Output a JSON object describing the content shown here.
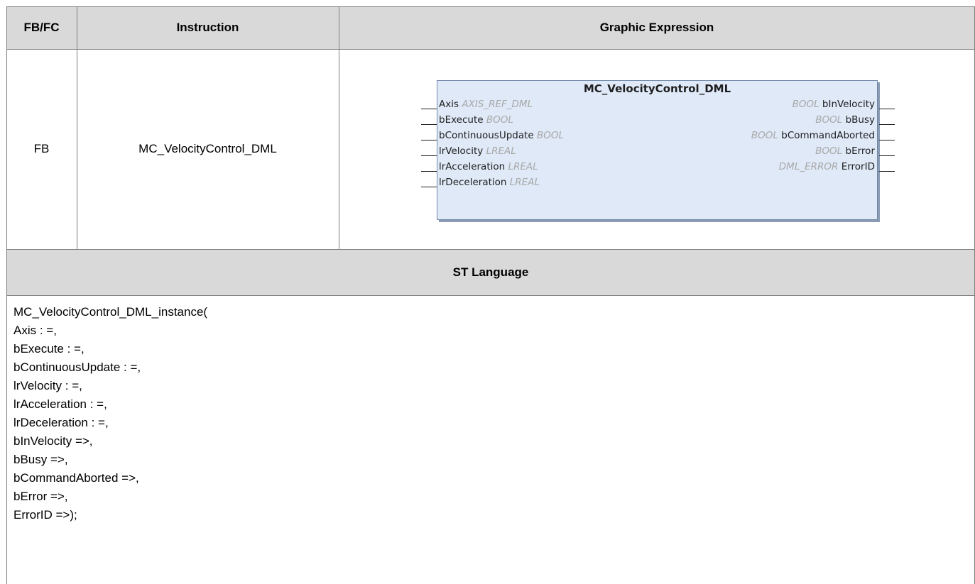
{
  "table": {
    "headers": {
      "col1": "FB/FC",
      "col2": "Instruction",
      "col3": "Graphic Expression"
    },
    "row": {
      "fb_fc": "FB",
      "instruction": "MC_VelocityControl_DML"
    },
    "st_header": "ST Language"
  },
  "block": {
    "title": "MC_VelocityControl_DML",
    "inputs": [
      {
        "name": "Axis",
        "type": "AXIS_REF_DML"
      },
      {
        "name": "bExecute",
        "type": "BOOL"
      },
      {
        "name": "bContinuousUpdate",
        "type": "BOOL"
      },
      {
        "name": "lrVelocity",
        "type": "LREAL"
      },
      {
        "name": "lrAcceleration",
        "type": "LREAL"
      },
      {
        "name": "lrDeceleration",
        "type": "LREAL"
      }
    ],
    "outputs": [
      {
        "name": "bInVelocity",
        "type": "BOOL"
      },
      {
        "name": "bBusy",
        "type": "BOOL"
      },
      {
        "name": "bCommandAborted",
        "type": "BOOL"
      },
      {
        "name": "bError",
        "type": "BOOL"
      },
      {
        "name": "ErrorID",
        "type": "DML_ERROR"
      }
    ]
  },
  "st_code": [
    "MC_VelocityControl_DML_instance(",
    "Axis : =,",
    "bExecute : =,",
    "bContinuousUpdate : =,",
    "lrVelocity : =,",
    "lrAcceleration : =,",
    "lrDeceleration : =,",
    "bInVelocity =>,",
    "bBusy =>,",
    "bCommandAborted =>,",
    "bError =>,",
    "ErrorID =>);"
  ]
}
